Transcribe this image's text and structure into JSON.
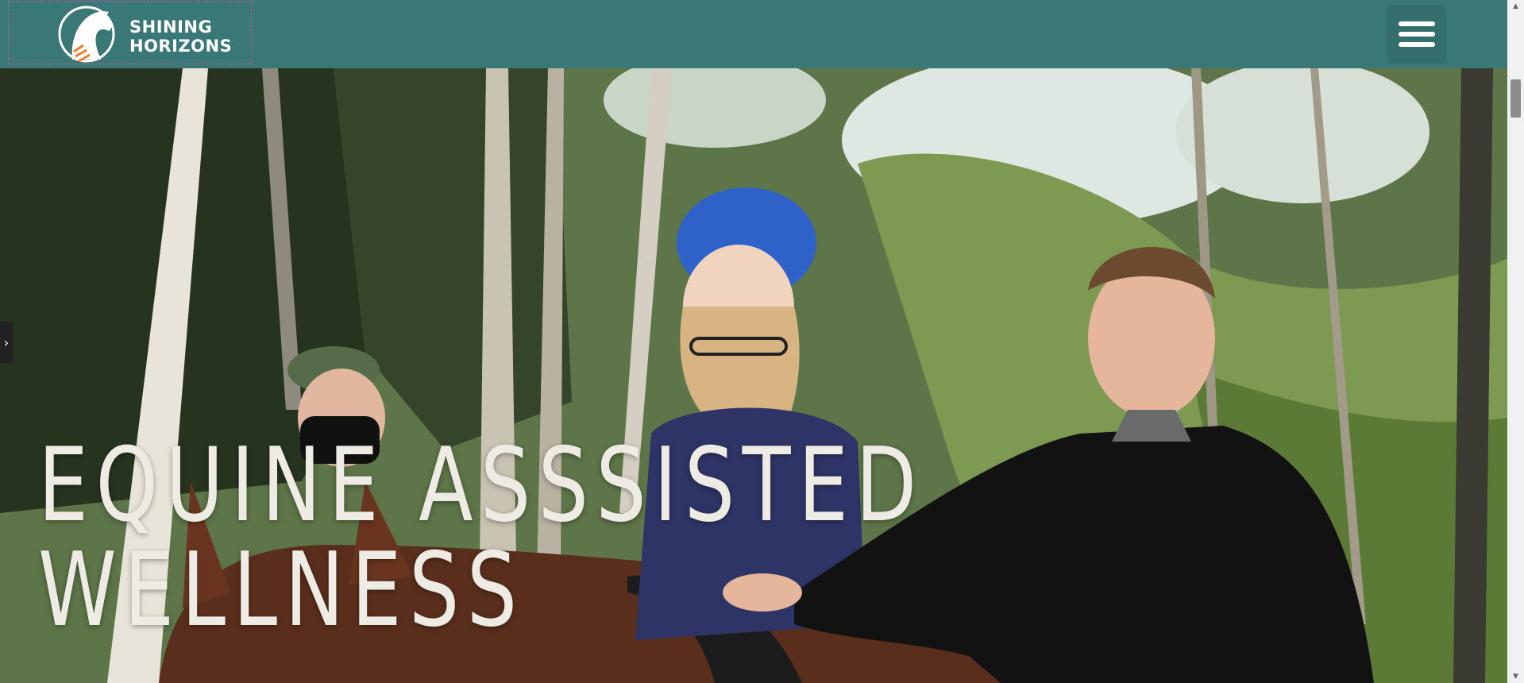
{
  "header": {
    "logo_line1": "SHINING",
    "logo_line2": "HORIZONS",
    "logo_icon": "horse-head-logo",
    "menu_icon": "hamburger-menu-icon",
    "background_color": "#3a7877"
  },
  "hero": {
    "title_line1": "EQUINE ASSSISTED",
    "title_line2": "WELLNESS",
    "image_description_icon": "hero-photo"
  },
  "slider": {
    "next_icon": "chevron-right-icon",
    "next_glyph": "›"
  },
  "scrollbar": {
    "up_glyph": "▲",
    "down_glyph": "▼"
  }
}
